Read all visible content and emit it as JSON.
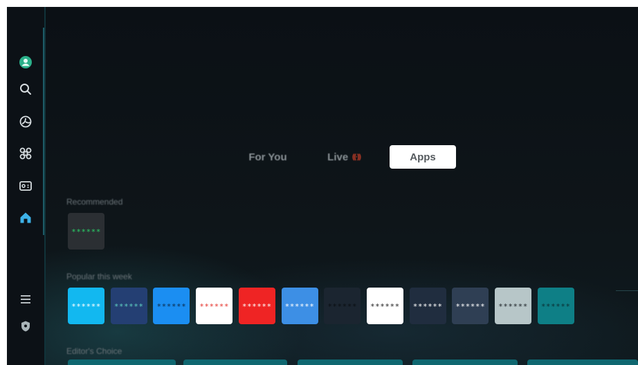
{
  "sidebar": {
    "items": [
      {
        "icon": "profile-icon",
        "color": "#2bb08a"
      },
      {
        "icon": "search-icon"
      },
      {
        "icon": "ambient-icon"
      },
      {
        "icon": "apps-grid-icon"
      },
      {
        "icon": "game-icon"
      },
      {
        "icon": "home-icon",
        "color": "#3db2e8",
        "active": true
      },
      {
        "icon": "menu-icon"
      },
      {
        "icon": "privacy-shield-icon"
      }
    ]
  },
  "tabs": [
    {
      "label": "For You"
    },
    {
      "label": "Live",
      "badge_icon": "broadcast-icon",
      "badge_text": "((·))"
    },
    {
      "label": "Apps",
      "selected": true
    }
  ],
  "sections": {
    "recommended": {
      "title": "Recommended",
      "apps": [
        {
          "name": "******",
          "bg": "#2b2f33",
          "fg": "#2bcf68"
        }
      ]
    },
    "popular": {
      "title": "Popular this week",
      "apps": [
        {
          "name": "******",
          "bg": "#12b8f0",
          "fg": "#ffffff"
        },
        {
          "name": "******",
          "bg": "#243f73",
          "fg": "#5fd0c2"
        },
        {
          "name": "******",
          "bg": "#1b8ef2",
          "fg": "#0b2a4a"
        },
        {
          "name": "******",
          "bg": "#ffffff",
          "fg": "#e5322b"
        },
        {
          "name": "******",
          "bg": "#ef2424",
          "fg": "#ffffff"
        },
        {
          "name": "******",
          "bg": "#3d8fe5",
          "fg": "#ffffff"
        },
        {
          "name": "******",
          "bg": "#1b2530",
          "fg": "#0b0f13"
        },
        {
          "name": "******",
          "bg": "#ffffff",
          "fg": "#222222"
        },
        {
          "name": "******",
          "bg": "#202d3f",
          "fg": "#ffffff"
        },
        {
          "name": "******",
          "bg": "#2f3f54",
          "fg": "#ffffff"
        },
        {
          "name": "******",
          "bg": "#b7c6c8",
          "fg": "#20262b"
        },
        {
          "name": "******",
          "bg": "#0e7f86",
          "fg": "#0b2f33"
        }
      ]
    },
    "editors_choice": {
      "title": "Editor's Choice"
    }
  }
}
